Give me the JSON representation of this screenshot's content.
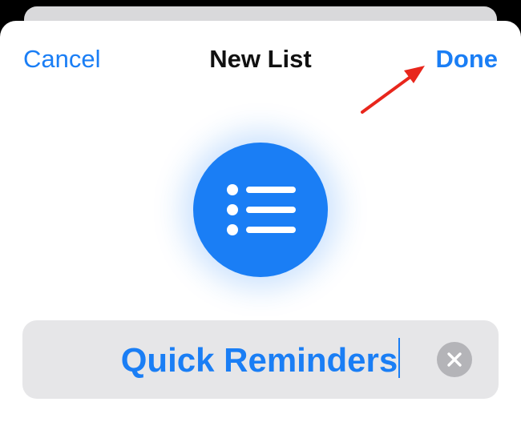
{
  "navbar": {
    "cancel_label": "Cancel",
    "title": "New List",
    "done_label": "Done"
  },
  "list_icon": {
    "icon": "list-bullet-icon",
    "color": "#1a7ef5"
  },
  "name_field": {
    "value": "Quick Reminders",
    "clear_icon": "clear-x-icon"
  },
  "annotation": {
    "arrow_color": "#e8261c",
    "points_to": "done-button"
  }
}
